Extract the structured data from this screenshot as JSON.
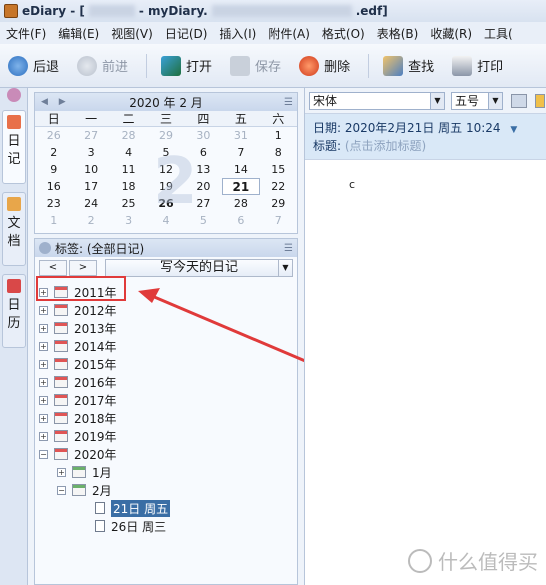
{
  "window": {
    "title_prefix": "eDiary - [",
    "title_mid": "- myDiary.",
    "title_suffix": ".edf]"
  },
  "menu": [
    "文件(F)",
    "编辑(E)",
    "视图(V)",
    "日记(D)",
    "插入(I)",
    "附件(A)",
    "格式(O)",
    "表格(B)",
    "收藏(R)",
    "工具("
  ],
  "toolbar": {
    "back": "后退",
    "forward": "前进",
    "open": "打开",
    "save": "保存",
    "delete": "删除",
    "find": "查找",
    "print": "打印"
  },
  "sidetabs": {
    "diary": [
      "日",
      "记"
    ],
    "docs": [
      "文",
      "档"
    ],
    "calendar": [
      "日",
      "历"
    ]
  },
  "calendar": {
    "header": "2020  年  2  月",
    "big_month": "2",
    "weekdays": [
      "日",
      "一",
      "二",
      "三",
      "四",
      "五",
      "六"
    ],
    "weeks": [
      [
        [
          "26",
          "other"
        ],
        [
          "27",
          "other"
        ],
        [
          "28",
          "other"
        ],
        [
          "29",
          "other"
        ],
        [
          "30",
          "other"
        ],
        [
          "31",
          "other"
        ],
        [
          "1",
          ""
        ]
      ],
      [
        [
          "2",
          ""
        ],
        [
          "3",
          ""
        ],
        [
          "4",
          ""
        ],
        [
          "5",
          ""
        ],
        [
          "6",
          ""
        ],
        [
          "7",
          ""
        ],
        [
          "8",
          ""
        ]
      ],
      [
        [
          "9",
          ""
        ],
        [
          "10",
          ""
        ],
        [
          "11",
          ""
        ],
        [
          "12",
          ""
        ],
        [
          "13",
          ""
        ],
        [
          "14",
          ""
        ],
        [
          "15",
          ""
        ]
      ],
      [
        [
          "16",
          ""
        ],
        [
          "17",
          ""
        ],
        [
          "18",
          ""
        ],
        [
          "19",
          ""
        ],
        [
          "20",
          ""
        ],
        [
          "21",
          "today"
        ],
        [
          "22",
          ""
        ]
      ],
      [
        [
          "23",
          ""
        ],
        [
          "24",
          ""
        ],
        [
          "25",
          ""
        ],
        [
          "26",
          "bold"
        ],
        [
          "27",
          ""
        ],
        [
          "28",
          ""
        ],
        [
          "29",
          ""
        ]
      ],
      [
        [
          "1",
          "other"
        ],
        [
          "2",
          "other"
        ],
        [
          "3",
          "other"
        ],
        [
          "4",
          "other"
        ],
        [
          "5",
          "other"
        ],
        [
          "6",
          "other"
        ],
        [
          "7",
          "other"
        ]
      ]
    ]
  },
  "tags": {
    "header": "标签: (全部日记)",
    "prev": "<",
    "next": ">",
    "write_today": "写今天的日记"
  },
  "tree": {
    "years": [
      "2011年",
      "2012年",
      "2013年",
      "2014年",
      "2015年",
      "2016年",
      "2017年",
      "2018年",
      "2019年"
    ],
    "year_2020": "2020年",
    "jan": "1月",
    "feb": "2月",
    "entry1": "21日 周五",
    "entry2": "26日 周三"
  },
  "editor": {
    "font": "宋体",
    "size": "五号",
    "date_label": "日期:",
    "date_value": "2020年2月21日 周五 10:24",
    "title_label": "标题:",
    "title_placeholder": "(点击添加标题)",
    "body": "c"
  },
  "watermark": "什么值得买",
  "colors": {
    "highlight": "#e03a3a",
    "selection": "#3a6ea5"
  }
}
